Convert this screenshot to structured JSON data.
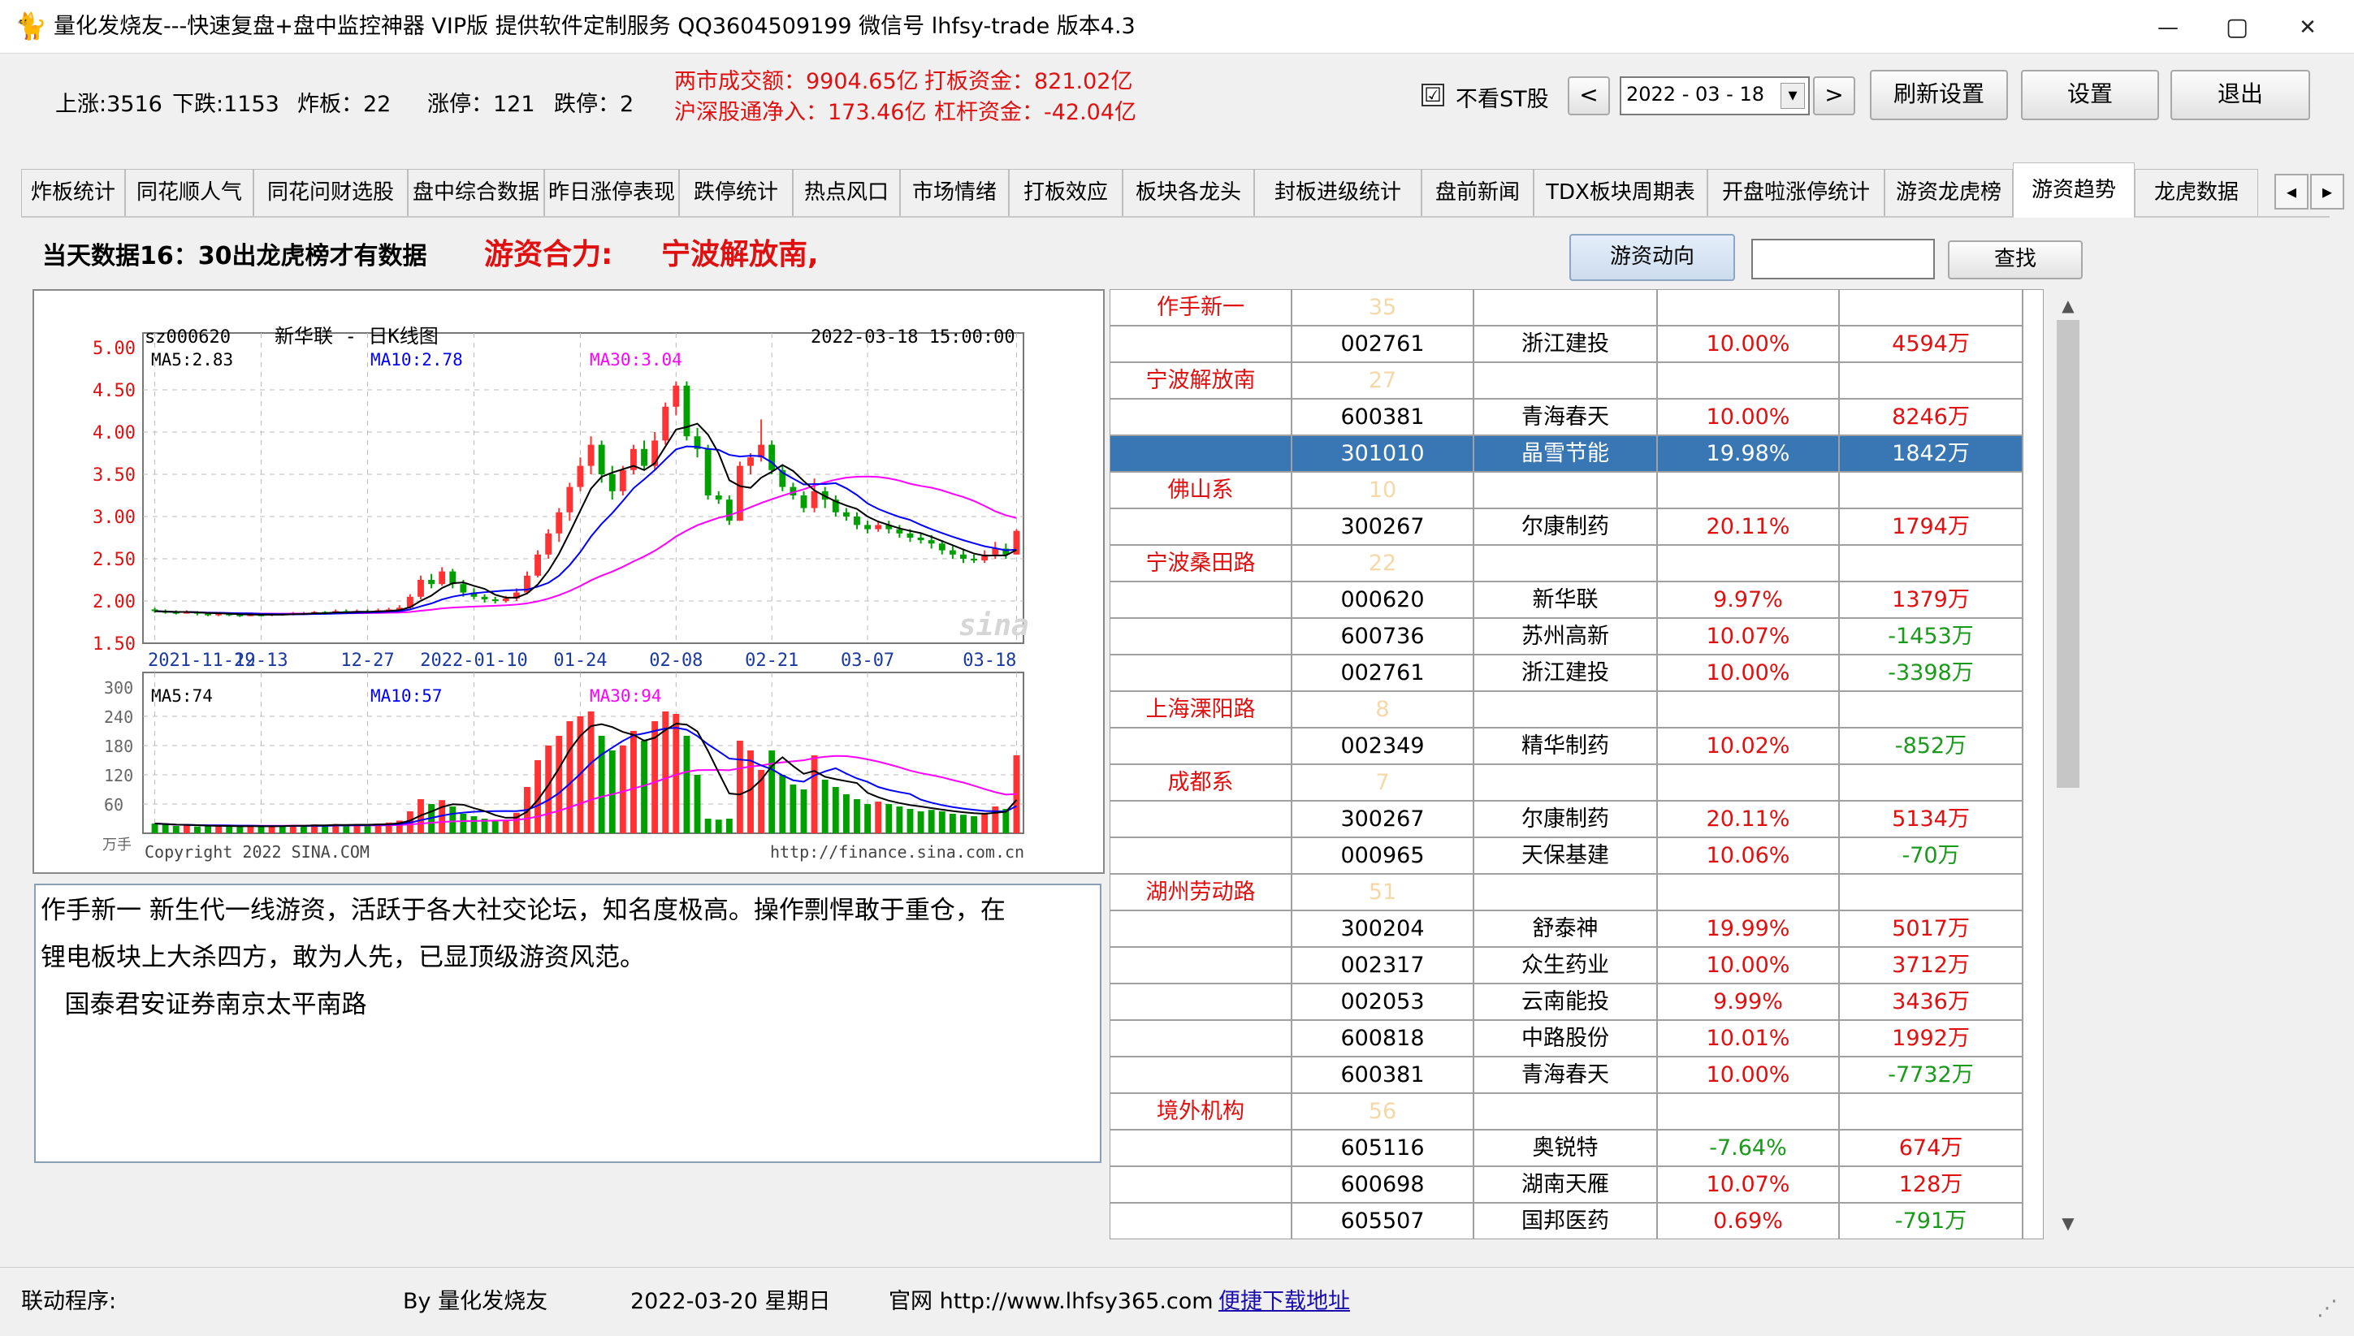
{
  "window": {
    "title": "量化发烧友---快速复盘+盘中监控神器 VIP版  提供软件定制服务 QQ3604509199 微信号 lhfsy-trade   版本4.3",
    "logo_icon": "cat-logo-icon",
    "minimize_glyph": "—",
    "maximize_glyph": "▢",
    "close_glyph": "✕"
  },
  "summary": {
    "up": "上涨:3516",
    "down": "下跌:1153",
    "broken": "炸板：22",
    "limit_up": "涨停：121",
    "limit_down": "跌停：2",
    "turnover": "两市成交额：9904.65亿",
    "board_funds": "打板资金：821.02亿",
    "northbound": "沪深股通净入：173.46亿",
    "leverage": "杠杆资金：-42.04亿"
  },
  "toolbar": {
    "hide_st_label": "不看ST股",
    "hide_st_checked": "☑",
    "prev_glyph": "<",
    "next_glyph": ">",
    "date_value": "2022 - 03 - 18",
    "date_dropdown_glyph": "▾",
    "refresh_label": "刷新设置",
    "settings_label": "设置",
    "exit_label": "退出"
  },
  "tabs": [
    {
      "label": "炸板统计"
    },
    {
      "label": "同花顺人气"
    },
    {
      "label": "同花问财选股"
    },
    {
      "label": "盘中综合数据"
    },
    {
      "label": "昨日涨停表现"
    },
    {
      "label": "跌停统计"
    },
    {
      "label": "热点风口"
    },
    {
      "label": "市场情绪"
    },
    {
      "label": "打板效应"
    },
    {
      "label": "板块各龙头"
    },
    {
      "label": "封板进级统计"
    },
    {
      "label": "盘前新闻"
    },
    {
      "label": "TDX板块周期表"
    },
    {
      "label": "开盘啦涨停统计"
    },
    {
      "label": "游资龙虎榜"
    },
    {
      "label": "游资趋势"
    },
    {
      "label": "龙虎数据"
    }
  ],
  "tab_scroll": {
    "left": "◂",
    "right": "▸"
  },
  "content": {
    "day_info": "当天数据16：30出龙虎榜才有数据",
    "combine_label": "游资合力:",
    "combine_value": "宁波解放南,",
    "flow_button": "游资动向",
    "search_placeholder": "",
    "search_button": "查找"
  },
  "kline": {
    "code": "sz000620",
    "name": "新华联 - 日K线图",
    "datetime": "2022-03-18 15:00:00",
    "ma5": "MA5:2.83",
    "ma10": "MA10:2.78",
    "ma30": "MA30:3.04",
    "vol_ma5": "MA5:74",
    "vol_ma10": "MA10:57",
    "vol_ma30": "MA30:94",
    "vol_unit": "万手",
    "copyright": "Copyright 2022 SINA.COM",
    "url": "http://finance.sina.com.cn",
    "watermark": "sina",
    "price_ticks": [
      "5.00",
      "4.50",
      "4.00",
      "3.50",
      "3.00",
      "2.50",
      "2.00",
      "1.50"
    ],
    "vol_ticks": [
      "300",
      "240",
      "180",
      "120",
      "60"
    ],
    "date_ticks": [
      "2021-11-29",
      "12-13",
      "12-27",
      "2022-01-10",
      "01-24",
      "02-08",
      "02-21",
      "03-07",
      "03-18"
    ]
  },
  "chart_data": {
    "type": "candlestick",
    "price_ylim": [
      1.5,
      5.0
    ],
    "volume_ylim": [
      0,
      300
    ],
    "price_ma_colors": {
      "ma5": "#000000",
      "ma10": "#0000ff",
      "ma30": "#ff00ff"
    },
    "up_color": "#ff3333",
    "down_color": "#00a000",
    "candles": [
      [
        1.9,
        1.88,
        1.92,
        1.86,
        20
      ],
      [
        1.88,
        1.87,
        1.9,
        1.85,
        18
      ],
      [
        1.87,
        1.86,
        1.89,
        1.84,
        15
      ],
      [
        1.86,
        1.87,
        1.89,
        1.85,
        16
      ],
      [
        1.87,
        1.85,
        1.88,
        1.83,
        14
      ],
      [
        1.85,
        1.84,
        1.87,
        1.82,
        15
      ],
      [
        1.84,
        1.85,
        1.86,
        1.82,
        16
      ],
      [
        1.85,
        1.84,
        1.86,
        1.82,
        14
      ],
      [
        1.84,
        1.83,
        1.86,
        1.81,
        13
      ],
      [
        1.83,
        1.84,
        1.85,
        1.82,
        15
      ],
      [
        1.84,
        1.83,
        1.85,
        1.82,
        14
      ],
      [
        1.83,
        1.85,
        1.86,
        1.82,
        16
      ],
      [
        1.85,
        1.84,
        1.86,
        1.83,
        15
      ],
      [
        1.84,
        1.86,
        1.87,
        1.83,
        17
      ],
      [
        1.86,
        1.85,
        1.87,
        1.84,
        15
      ],
      [
        1.85,
        1.87,
        1.88,
        1.84,
        18
      ],
      [
        1.87,
        1.86,
        1.88,
        1.85,
        16
      ],
      [
        1.86,
        1.88,
        1.9,
        1.85,
        19
      ],
      [
        1.88,
        1.87,
        1.9,
        1.86,
        17
      ],
      [
        1.87,
        1.88,
        1.9,
        1.86,
        18
      ],
      [
        1.88,
        1.87,
        1.9,
        1.86,
        17
      ],
      [
        1.87,
        1.89,
        1.91,
        1.86,
        20
      ],
      [
        1.89,
        1.9,
        1.92,
        1.88,
        22
      ],
      [
        1.9,
        1.92,
        1.95,
        1.89,
        26
      ],
      [
        1.92,
        2.05,
        2.08,
        1.91,
        45
      ],
      [
        2.05,
        2.25,
        2.3,
        2.02,
        70
      ],
      [
        2.25,
        2.2,
        2.32,
        2.15,
        60
      ],
      [
        2.2,
        2.35,
        2.4,
        2.18,
        68
      ],
      [
        2.35,
        2.2,
        2.38,
        2.15,
        55
      ],
      [
        2.2,
        2.1,
        2.25,
        2.05,
        40
      ],
      [
        2.1,
        2.05,
        2.15,
        2.02,
        35
      ],
      [
        2.05,
        2.02,
        2.08,
        1.98,
        30
      ],
      [
        2.02,
        2.0,
        2.05,
        1.97,
        26
      ],
      [
        2.0,
        2.03,
        2.06,
        1.98,
        28
      ],
      [
        2.03,
        2.1,
        2.15,
        2.0,
        42
      ],
      [
        2.1,
        2.3,
        2.35,
        2.08,
        95
      ],
      [
        2.3,
        2.55,
        2.6,
        2.28,
        150
      ],
      [
        2.55,
        2.8,
        2.85,
        2.5,
        180
      ],
      [
        2.8,
        3.05,
        3.1,
        2.7,
        200
      ],
      [
        3.05,
        3.35,
        3.4,
        2.95,
        230
      ],
      [
        3.35,
        3.6,
        3.7,
        3.3,
        240
      ],
      [
        3.6,
        3.85,
        3.95,
        3.5,
        250
      ],
      [
        3.85,
        3.5,
        3.9,
        3.4,
        200
      ],
      [
        3.5,
        3.3,
        3.6,
        3.2,
        170
      ],
      [
        3.3,
        3.55,
        3.6,
        3.25,
        180
      ],
      [
        3.55,
        3.8,
        3.85,
        3.5,
        210
      ],
      [
        3.8,
        3.6,
        3.9,
        3.55,
        190
      ],
      [
        3.6,
        3.9,
        4.0,
        3.55,
        230
      ],
      [
        3.9,
        4.3,
        4.35,
        3.85,
        250
      ],
      [
        4.3,
        4.55,
        4.6,
        4.2,
        245
      ],
      [
        4.55,
        3.95,
        4.6,
        3.9,
        200
      ],
      [
        3.95,
        3.8,
        4.05,
        3.7,
        120
      ],
      [
        3.8,
        3.25,
        3.85,
        3.2,
        30
      ],
      [
        3.25,
        3.2,
        3.3,
        3.15,
        28
      ],
      [
        3.2,
        2.95,
        3.25,
        2.9,
        30
      ],
      [
        2.95,
        3.6,
        3.65,
        2.95,
        190
      ],
      [
        3.6,
        3.7,
        3.75,
        3.5,
        170
      ],
      [
        3.7,
        3.85,
        4.15,
        3.65,
        130
      ],
      [
        3.85,
        3.55,
        3.9,
        3.5,
        170
      ],
      [
        3.55,
        3.35,
        3.6,
        3.3,
        120
      ],
      [
        3.35,
        3.25,
        3.4,
        3.2,
        100
      ],
      [
        3.25,
        3.1,
        3.3,
        3.05,
        90
      ],
      [
        3.1,
        3.3,
        3.45,
        3.05,
        160
      ],
      [
        3.3,
        3.2,
        3.35,
        3.1,
        110
      ],
      [
        3.2,
        3.05,
        3.25,
        3.0,
        95
      ],
      [
        3.05,
        3.0,
        3.1,
        2.95,
        80
      ],
      [
        3.0,
        2.9,
        3.05,
        2.85,
        70
      ],
      [
        2.9,
        2.85,
        2.95,
        2.8,
        60
      ],
      [
        2.85,
        2.9,
        2.95,
        2.82,
        65
      ],
      [
        2.9,
        2.85,
        2.95,
        2.8,
        60
      ],
      [
        2.85,
        2.8,
        2.9,
        2.75,
        55
      ],
      [
        2.8,
        2.75,
        2.85,
        2.7,
        50
      ],
      [
        2.75,
        2.72,
        2.8,
        2.68,
        45
      ],
      [
        2.72,
        2.68,
        2.78,
        2.62,
        48
      ],
      [
        2.68,
        2.6,
        2.72,
        2.55,
        45
      ],
      [
        2.6,
        2.55,
        2.65,
        2.5,
        40
      ],
      [
        2.55,
        2.5,
        2.62,
        2.45,
        38
      ],
      [
        2.5,
        2.48,
        2.55,
        2.45,
        35
      ],
      [
        2.48,
        2.55,
        2.6,
        2.45,
        42
      ],
      [
        2.55,
        2.62,
        2.7,
        2.5,
        55
      ],
      [
        2.62,
        2.55,
        2.68,
        2.5,
        50
      ],
      [
        2.55,
        2.83,
        2.85,
        2.55,
        160
      ]
    ]
  },
  "description": {
    "line1": "作手新一  新生代一线游资，活跃于各大社交论坛，知名度极高。操作剽悍敢于重仓，在",
    "line2": "锂电板块上大杀四方，敢为人先，已显顶级游资风范。",
    "line3": "   国泰君安证券南京太平南路"
  },
  "grid_rows": [
    {
      "type": "group",
      "name": "作手新一",
      "count": "35"
    },
    {
      "type": "stock",
      "code": "002761",
      "name": "浙江建投",
      "pct": "10.00%",
      "net": "4594万",
      "pct_color": "#e01010",
      "net_color": "#e01010"
    },
    {
      "type": "group",
      "name": "宁波解放南",
      "count": "27"
    },
    {
      "type": "stock",
      "code": "600381",
      "name": "青海春天",
      "pct": "10.00%",
      "net": "8246万",
      "pct_color": "#e01010",
      "net_color": "#e01010"
    },
    {
      "type": "stock",
      "selected": true,
      "code": "301010",
      "name": "晶雪节能",
      "pct": "19.98%",
      "net": "1842万",
      "pct_color": "#ffffff",
      "net_color": "#ffffff"
    },
    {
      "type": "group",
      "name": "佛山系",
      "count": "10"
    },
    {
      "type": "stock",
      "code": "300267",
      "name": "尔康制药",
      "pct": "20.11%",
      "net": "1794万",
      "pct_color": "#e01010",
      "net_color": "#e01010"
    },
    {
      "type": "group",
      "name": "宁波桑田路",
      "count": "22"
    },
    {
      "type": "stock",
      "code": "000620",
      "name": "新华联",
      "pct": "9.97%",
      "net": "1379万",
      "pct_color": "#e01010",
      "net_color": "#e01010"
    },
    {
      "type": "stock",
      "code": "600736",
      "name": "苏州高新",
      "pct": "10.07%",
      "net": "-1453万",
      "pct_color": "#e01010",
      "net_color": "#1a9a1a"
    },
    {
      "type": "stock",
      "code": "002761",
      "name": "浙江建投",
      "pct": "10.00%",
      "net": "-3398万",
      "pct_color": "#e01010",
      "net_color": "#1a9a1a"
    },
    {
      "type": "group",
      "name": "上海溧阳路",
      "count": "8"
    },
    {
      "type": "stock",
      "code": "002349",
      "name": "精华制药",
      "pct": "10.02%",
      "net": "-852万",
      "pct_color": "#e01010",
      "net_color": "#1a9a1a"
    },
    {
      "type": "group",
      "name": "成都系",
      "count": "7"
    },
    {
      "type": "stock",
      "code": "300267",
      "name": "尔康制药",
      "pct": "20.11%",
      "net": "5134万",
      "pct_color": "#e01010",
      "net_color": "#e01010"
    },
    {
      "type": "stock",
      "code": "000965",
      "name": "天保基建",
      "pct": "10.06%",
      "net": "-70万",
      "pct_color": "#e01010",
      "net_color": "#1a9a1a"
    },
    {
      "type": "group",
      "name": "湖州劳动路",
      "count": "51"
    },
    {
      "type": "stock",
      "code": "300204",
      "name": "舒泰神",
      "pct": "19.99%",
      "net": "5017万",
      "pct_color": "#e01010",
      "net_color": "#e01010"
    },
    {
      "type": "stock",
      "code": "002317",
      "name": "众生药业",
      "pct": "10.00%",
      "net": "3712万",
      "pct_color": "#e01010",
      "net_color": "#e01010"
    },
    {
      "type": "stock",
      "code": "002053",
      "name": "云南能投",
      "pct": "9.99%",
      "net": "3436万",
      "pct_color": "#e01010",
      "net_color": "#e01010"
    },
    {
      "type": "stock",
      "code": "600818",
      "name": "中路股份",
      "pct": "10.01%",
      "net": "1992万",
      "pct_color": "#e01010",
      "net_color": "#e01010"
    },
    {
      "type": "stock",
      "code": "600381",
      "name": "青海春天",
      "pct": "10.00%",
      "net": "-7732万",
      "pct_color": "#e01010",
      "net_color": "#1a9a1a"
    },
    {
      "type": "group",
      "name": "境外机构",
      "count": "56"
    },
    {
      "type": "stock",
      "code": "605116",
      "name": "奥锐特",
      "pct": "-7.64%",
      "net": "674万",
      "pct_color": "#1a9a1a",
      "net_color": "#e01010"
    },
    {
      "type": "stock",
      "code": "600698",
      "name": "湖南天雁",
      "pct": "10.07%",
      "net": "128万",
      "pct_color": "#e01010",
      "net_color": "#e01010"
    },
    {
      "type": "stock",
      "code": "605507",
      "name": "国邦医药",
      "pct": "0.69%",
      "net": "-791万",
      "pct_color": "#e01010",
      "net_color": "#1a9a1a"
    }
  ],
  "scroll": {
    "up": "▲",
    "down": "▼"
  },
  "status": {
    "link_program": "联动程序:",
    "by": "By 量化发烧友",
    "date": "2022-03-20 星期日",
    "site": "官网 http://www.lhfsy365.com",
    "download": "便捷下载地址",
    "grip": "⋰"
  }
}
